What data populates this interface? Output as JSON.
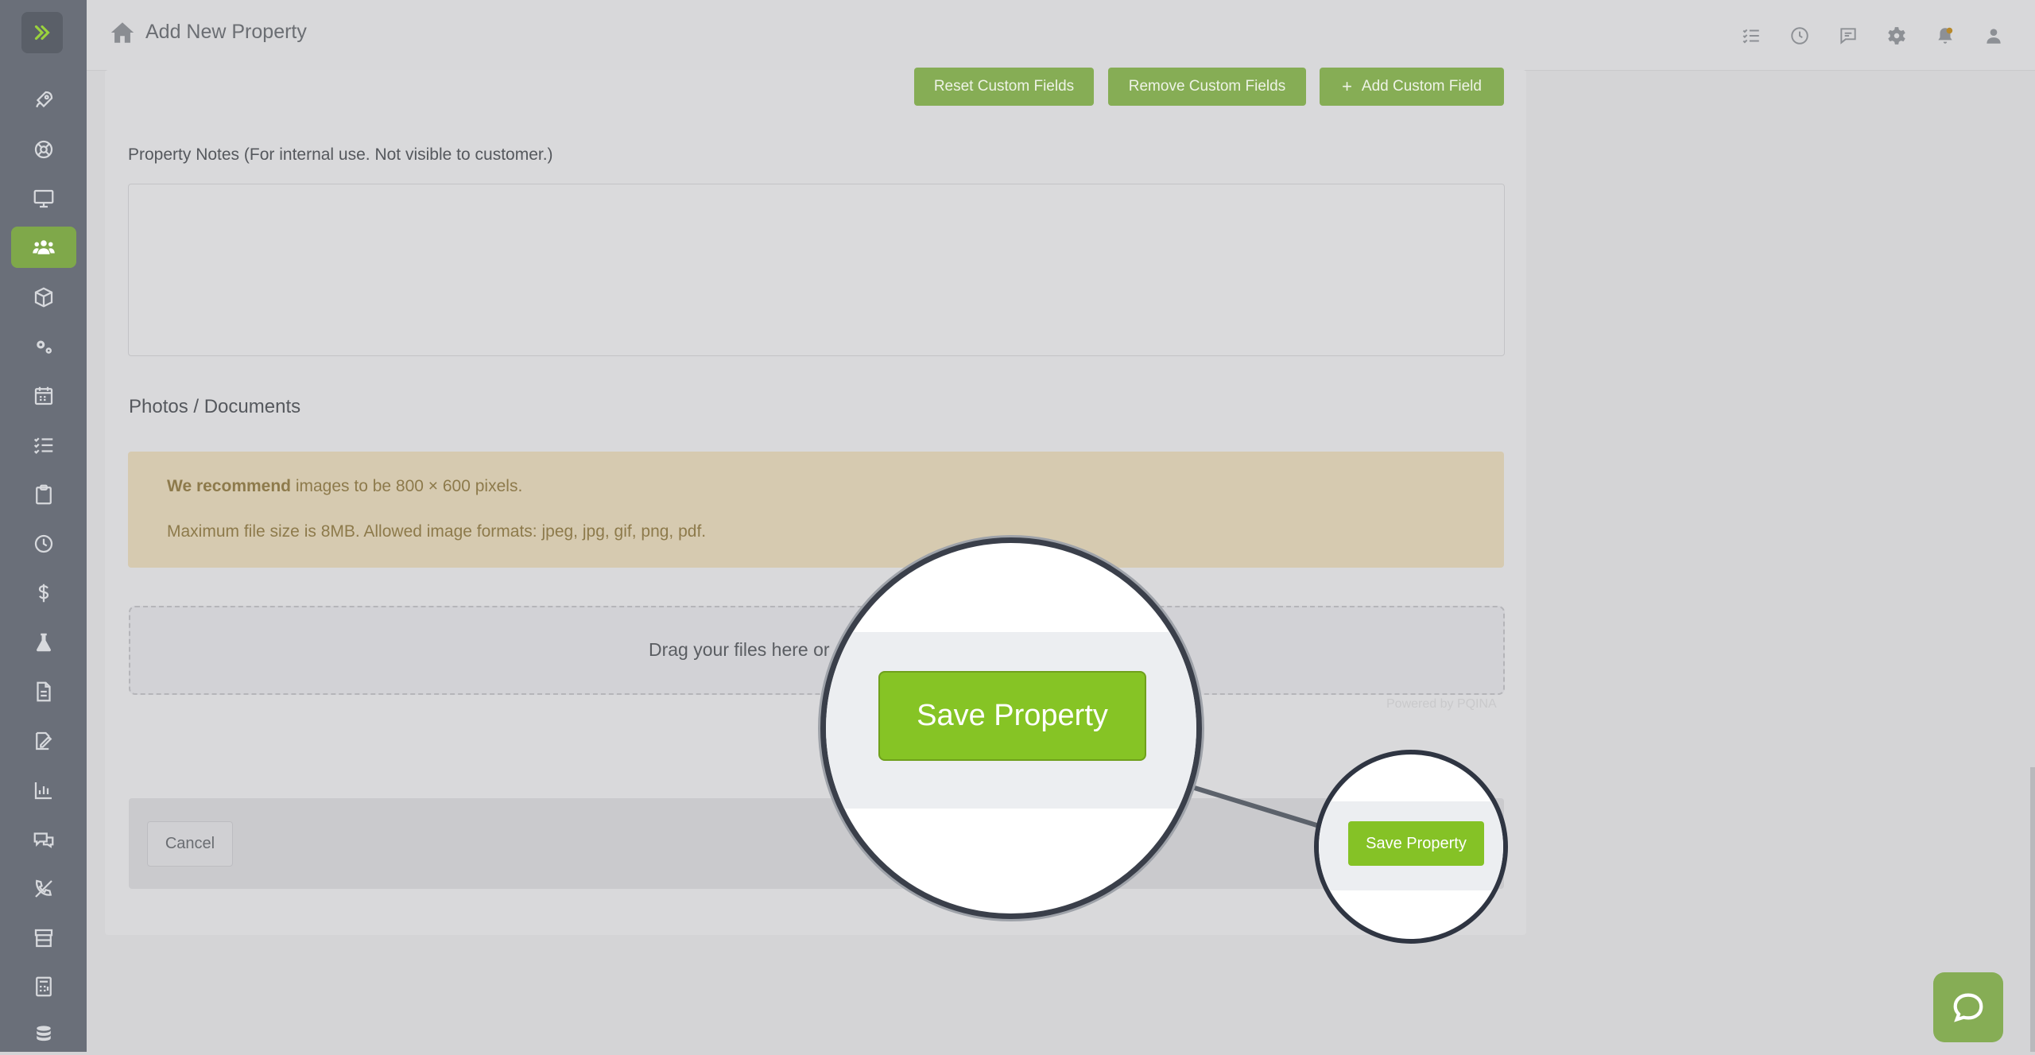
{
  "header": {
    "title": "Add New Property"
  },
  "custom_fields": {
    "reset_label": "Reset Custom Fields",
    "remove_label": "Remove Custom Fields",
    "add_label": "Add Custom Field"
  },
  "notes": {
    "label": "Property Notes (For internal use. Not visible to customer.)",
    "value": ""
  },
  "photos": {
    "heading": "Photos / Documents",
    "alert_bold": "We recommend",
    "alert_line1": " images to be 800 × 600 pixels.",
    "alert_line2": "Maximum file size is 8MB. Allowed image formats: jpeg, jpg, gif, png, pdf.",
    "dropzone_text": "Drag your files here or",
    "powered": "Powered by PQINA"
  },
  "footer": {
    "cancel_label": "Cancel",
    "save_label": "Save Property"
  },
  "sidebar": {
    "items": [
      "rocket",
      "support",
      "desktop",
      "customers",
      "box",
      "gears",
      "calendar",
      "tasks",
      "clipboard",
      "clock",
      "dollar",
      "flask",
      "document",
      "signature",
      "chart",
      "chat",
      "phone",
      "store",
      "calculator",
      "database"
    ],
    "active": "customers"
  },
  "colors": {
    "accent": "#85c226",
    "sidebar": "#6a6f79",
    "alert_bg": "#d6cab0"
  }
}
